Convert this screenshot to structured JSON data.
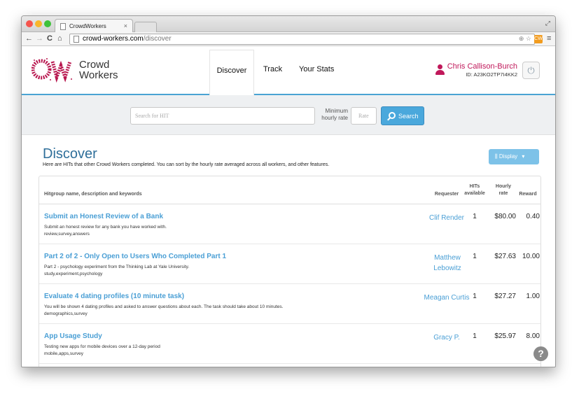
{
  "browser": {
    "tab_title": "CrowdWorkers",
    "tab_close": "×",
    "url_host": "crowd-workers.com",
    "url_path": "/discover",
    "nav_back": "←",
    "nav_forward": "→",
    "nav_reload": "C",
    "nav_home": "⌂",
    "zoom_icon": "⊕",
    "star_icon": "☆",
    "wrench_icon": "⚒",
    "menu_icon": "≡",
    "resize_icon": "⤢",
    "ext_label": "CW"
  },
  "header": {
    "brand_line1": "Crowd",
    "brand_line2": "Workers",
    "tabs": [
      {
        "label": "Discover",
        "active": true
      },
      {
        "label": "Track",
        "active": false
      },
      {
        "label": "Your Stats",
        "active": false
      }
    ],
    "user_name": "Chris Callison-Burch",
    "user_id": "ID: A23KO2TP7I4KK2",
    "power_icon": "⏻",
    "accent_color": "#4aa3d3",
    "user_color": "#c0185a"
  },
  "search": {
    "placeholder": "Search for HIT",
    "min_label_1": "Minimum",
    "min_label_2": "hourly rate",
    "rate_placeholder": "Rate",
    "button_label": "Search"
  },
  "main": {
    "title": "Discover",
    "subtitle": "Here are HITs that other Crowd Workers completed. You can sort by the hourly rate averaged across all workers, and other features.",
    "display_label": "Display",
    "display_icon": "⫼",
    "display_caret": "▾",
    "columns": {
      "name": "Hitgroup name, description and keywords",
      "requester": "Requester",
      "hits_1": "HITs",
      "hits_2": "available",
      "rate_1": "Hourly",
      "rate_2": "rate",
      "reward": "Reward"
    },
    "rows": [
      {
        "title": "Submit an Honest Review of a Bank",
        "description": "Submit an honest review for any bank you have worked with.",
        "keywords": "review,survey,answers",
        "requester": "Clif Render",
        "hits": "1",
        "rate": "$80.00",
        "reward": "0.40"
      },
      {
        "title": "Part 2 of 2 - Only Open to Users Who Completed Part 1",
        "description": "Part 2 - psychology experiment from the Thinking Lab at Yale University.",
        "keywords": "study,experiment,psychology",
        "requester": "Matthew Lebowitz",
        "hits": "1",
        "rate": "$27.63",
        "reward": "10.00"
      },
      {
        "title": "Evaluate 4 dating profiles (10 minute task)",
        "description": "You will be shown 4 dating profiles and asked to answer questions about each. The task should take about 10 minutes.",
        "keywords": "demographics,survey",
        "requester": "Meagan Curtis",
        "hits": "1",
        "rate": "$27.27",
        "reward": "1.00"
      },
      {
        "title": "App Usage Study",
        "description": "Testing new apps for mobile devices over a 12-day period",
        "keywords": "mobile,apps,survey",
        "requester": "Gracy P.",
        "hits": "1",
        "rate": "$25.97",
        "reward": "8.00"
      }
    ],
    "help_label": "?"
  }
}
